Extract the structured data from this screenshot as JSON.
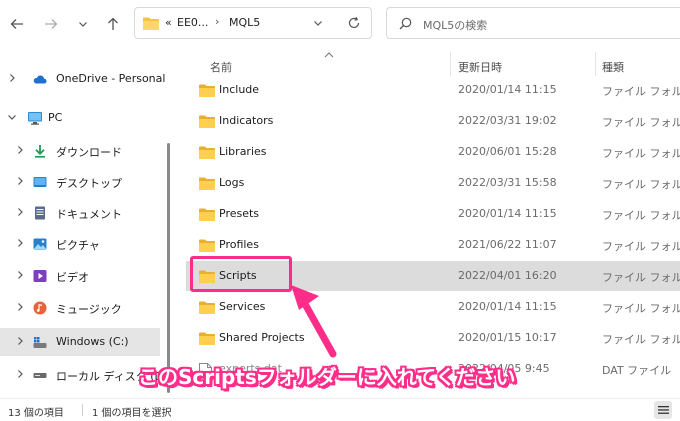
{
  "toolbar": {
    "back_icon": "arrow-left-icon",
    "forward_icon": "arrow-right-icon",
    "recent_icon": "chevron-down-icon",
    "up_icon": "arrow-up-icon"
  },
  "address": {
    "overflow": "«",
    "crumbs": [
      "EE0...",
      "MQL5"
    ],
    "separator": "›"
  },
  "search": {
    "placeholder": "MQL5の検索"
  },
  "sidebar": {
    "items": [
      {
        "label": "OneDrive - Personal",
        "icon": "cloud-icon"
      },
      {
        "label": "PC",
        "icon": "monitor-icon"
      },
      {
        "label": "ダウンロード",
        "icon": "download-icon"
      },
      {
        "label": "デスクトップ",
        "icon": "desktop-icon"
      },
      {
        "label": "ドキュメント",
        "icon": "document-icon"
      },
      {
        "label": "ピクチャ",
        "icon": "pictures-icon"
      },
      {
        "label": "ビデオ",
        "icon": "video-icon"
      },
      {
        "label": "ミュージック",
        "icon": "music-icon"
      },
      {
        "label": "Windows (C:)",
        "icon": "drive-icon"
      },
      {
        "label": "ローカル ディスク (D:)",
        "icon": "disk-icon"
      }
    ]
  },
  "columns": {
    "name": "名前",
    "date": "更新日時",
    "type": "種類"
  },
  "files": [
    {
      "name": "Include",
      "date": "2020/01/14 11:15",
      "type": "ファイル フォルダー"
    },
    {
      "name": "Indicators",
      "date": "2022/03/31 19:02",
      "type": "ファイル フォルダー"
    },
    {
      "name": "Libraries",
      "date": "2020/06/01 15:28",
      "type": "ファイル フォルダー"
    },
    {
      "name": "Logs",
      "date": "2022/03/31 15:58",
      "type": "ファイル フォルダー"
    },
    {
      "name": "Presets",
      "date": "2020/01/14 11:15",
      "type": "ファイル フォルダー"
    },
    {
      "name": "Profiles",
      "date": "2021/06/22 11:07",
      "type": "ファイル フォルダー"
    },
    {
      "name": "Scripts",
      "date": "2022/04/01 16:20",
      "type": "ファイル フォルダー"
    },
    {
      "name": "Services",
      "date": "2020/01/14 11:15",
      "type": "ファイル フォルダー"
    },
    {
      "name": "Shared Projects",
      "date": "2020/01/15 10:17",
      "type": "ファイル フォルダー"
    },
    {
      "name": "experts.dat",
      "date": "2022/04/05 9:45",
      "type": "DAT ファイル"
    }
  ],
  "annotation": {
    "text": "このScriptsフォルダーに入れてください",
    "color": "#ff2d8a"
  },
  "status": {
    "count": "13 個の項目",
    "selected": "1 個の項目を選択"
  },
  "colors": {
    "folder": "#f5c342",
    "selection": "#dcdcdc",
    "accent": "#ff2d8a"
  }
}
